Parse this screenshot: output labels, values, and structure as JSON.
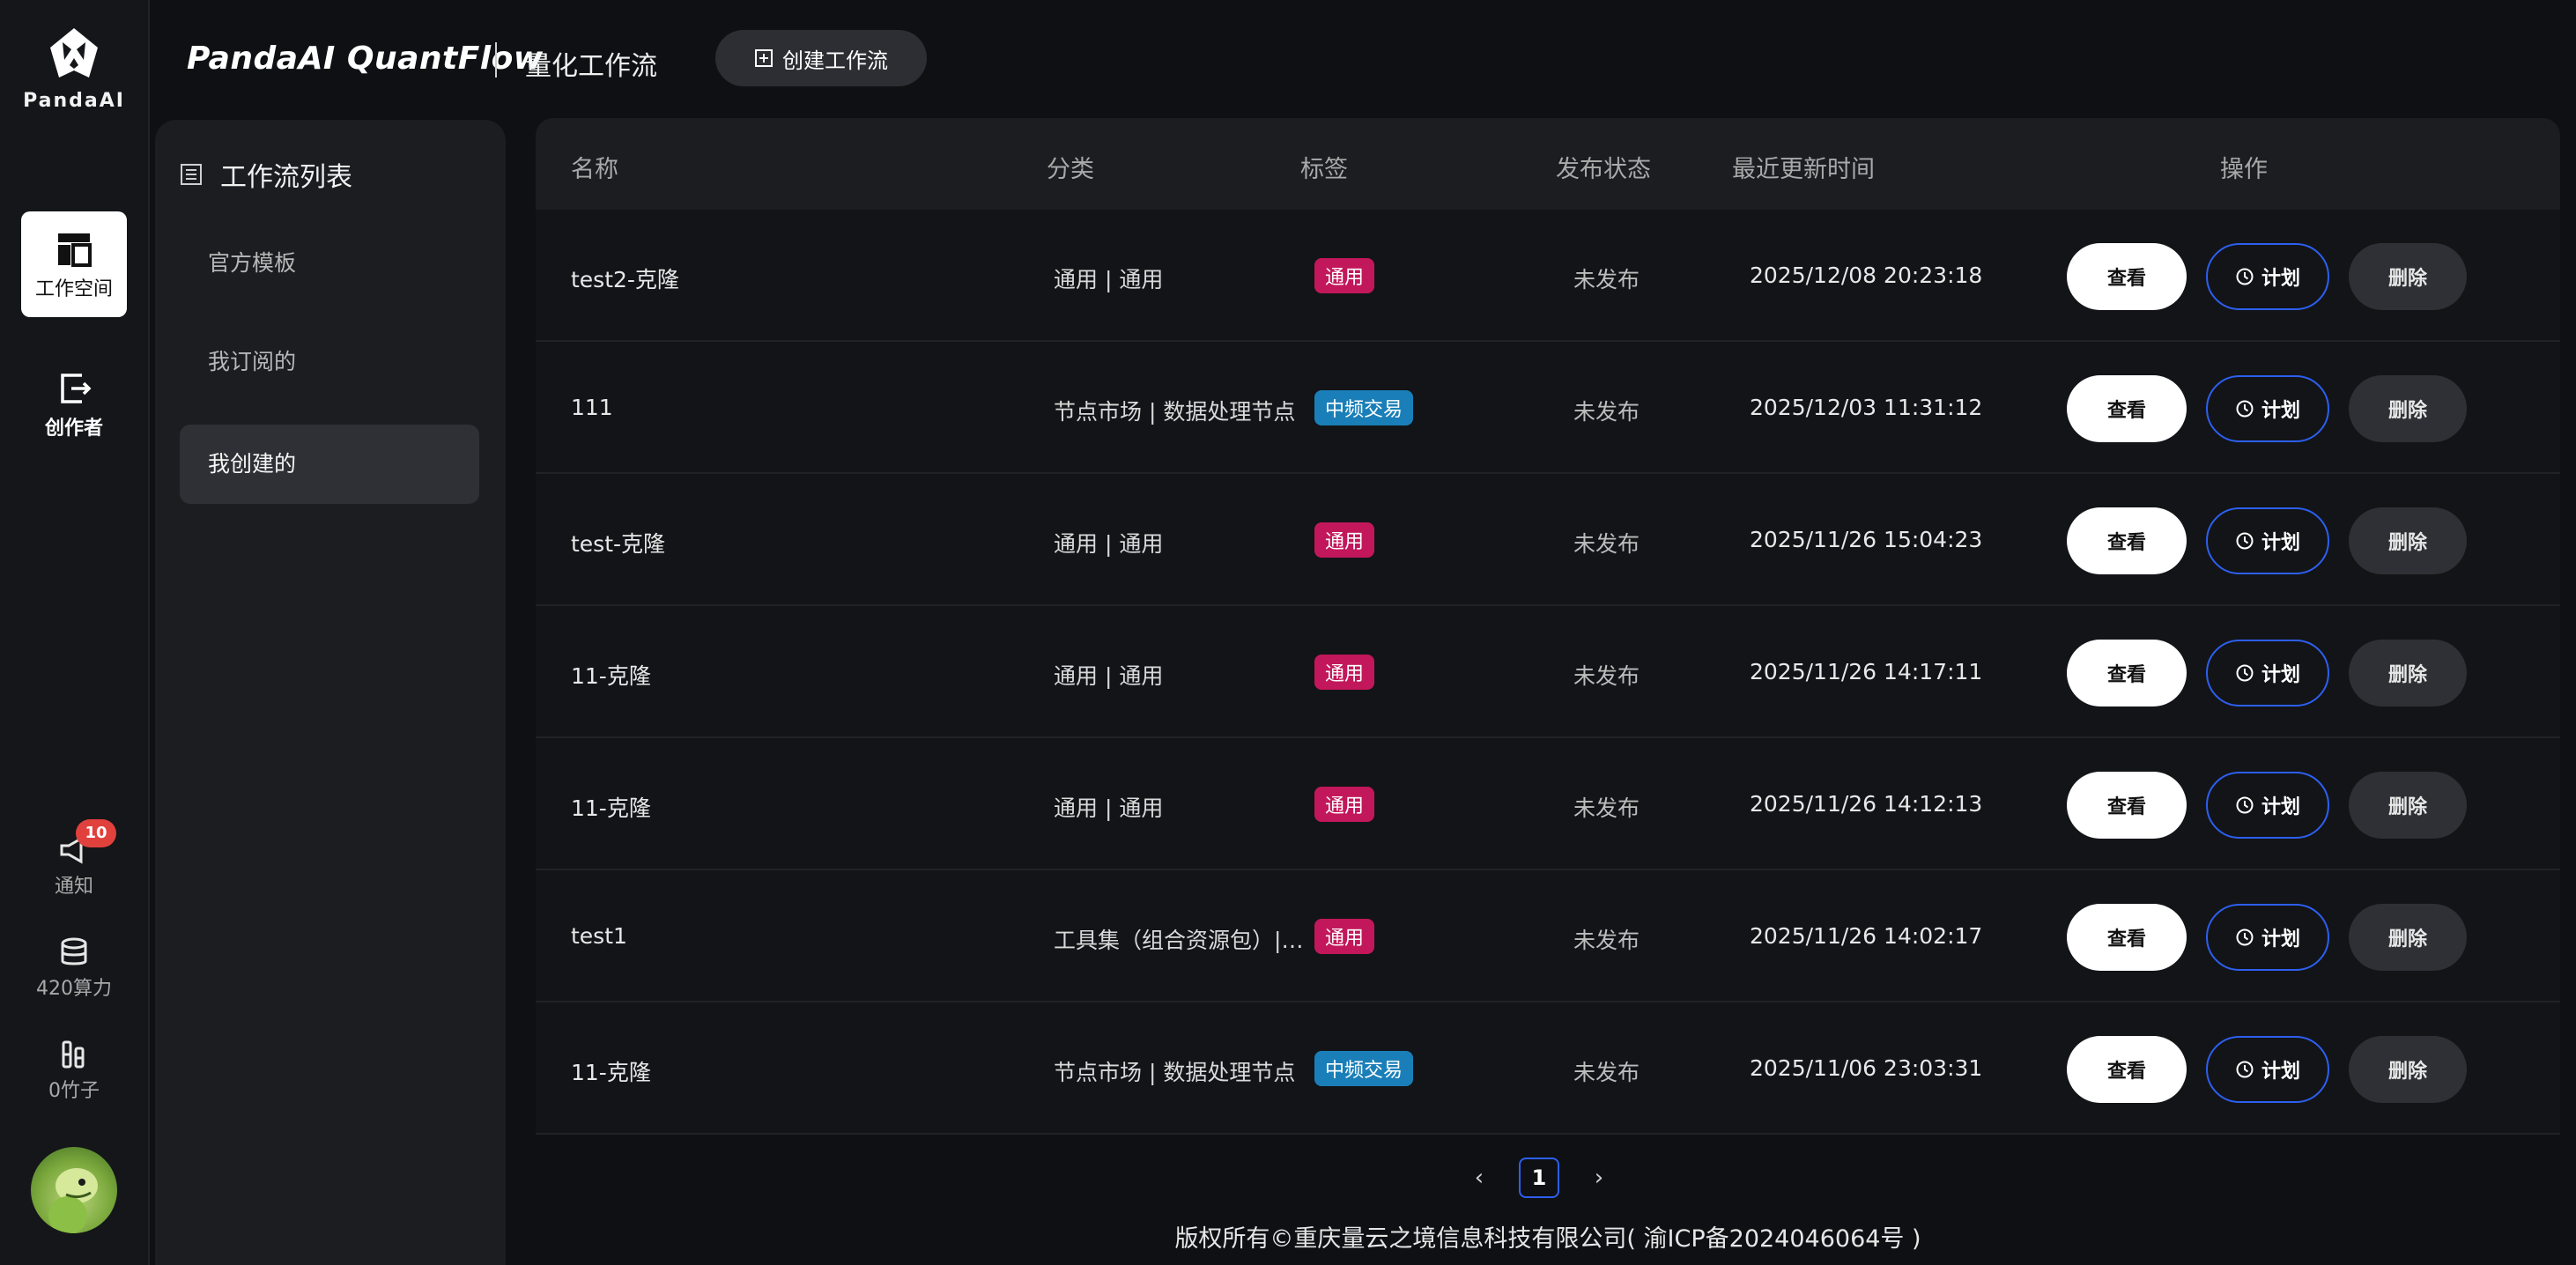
{
  "app": {
    "logo_text": "PandaAI",
    "brand": "PandaAI QuantFlow",
    "subtitle": "量化工作流",
    "create_button": "创建工作流"
  },
  "rail": {
    "workspace": "工作空间",
    "creator": "创作者",
    "notifications": "通知",
    "notification_count": "10",
    "compute": "420算力",
    "bamboo": "0竹子"
  },
  "panel": {
    "title": "工作流列表",
    "items": [
      "官方模板",
      "我订阅的",
      "我创建的"
    ],
    "active_index": 2
  },
  "table": {
    "headers": {
      "name": "名称",
      "category": "分类",
      "tag": "标签",
      "status": "发布状态",
      "updated": "最近更新时间",
      "actions": "操作"
    },
    "action_labels": {
      "view": "查看",
      "plan": "计划",
      "delete": "删除"
    },
    "rows": [
      {
        "name": "test2-克隆",
        "category": "通用 | 通用",
        "tag": "通用",
        "tag_color": "#c2185b",
        "status": "未发布",
        "updated": "2025/12/08 20:23:18"
      },
      {
        "name": "111",
        "category": "节点市场 | 数据处理节点",
        "tag": "中频交易",
        "tag_color": "#1a7fb8",
        "status": "未发布",
        "updated": "2025/12/03 11:31:12"
      },
      {
        "name": "test-克隆",
        "category": "通用 | 通用",
        "tag": "通用",
        "tag_color": "#c2185b",
        "status": "未发布",
        "updated": "2025/11/26 15:04:23"
      },
      {
        "name": "11-克隆",
        "category": "通用 | 通用",
        "tag": "通用",
        "tag_color": "#c2185b",
        "status": "未发布",
        "updated": "2025/11/26 14:17:11"
      },
      {
        "name": "11-克隆",
        "category": "通用 | 通用",
        "tag": "通用",
        "tag_color": "#c2185b",
        "status": "未发布",
        "updated": "2025/11/26 14:12:13"
      },
      {
        "name": "test1",
        "category": "工具集（组合资源包）| ...",
        "tag": "通用",
        "tag_color": "#c2185b",
        "status": "未发布",
        "updated": "2025/11/26 14:02:17"
      },
      {
        "name": "11-克隆",
        "category": "节点市场 | 数据处理节点",
        "tag": "中频交易",
        "tag_color": "#1a7fb8",
        "status": "未发布",
        "updated": "2025/11/06 23:03:31"
      }
    ]
  },
  "pagination": {
    "current": "1",
    "prev": "‹",
    "next": "›"
  },
  "footer": "版权所有©重庆量云之境信息科技有限公司( 渝ICP备2024046064号 )"
}
